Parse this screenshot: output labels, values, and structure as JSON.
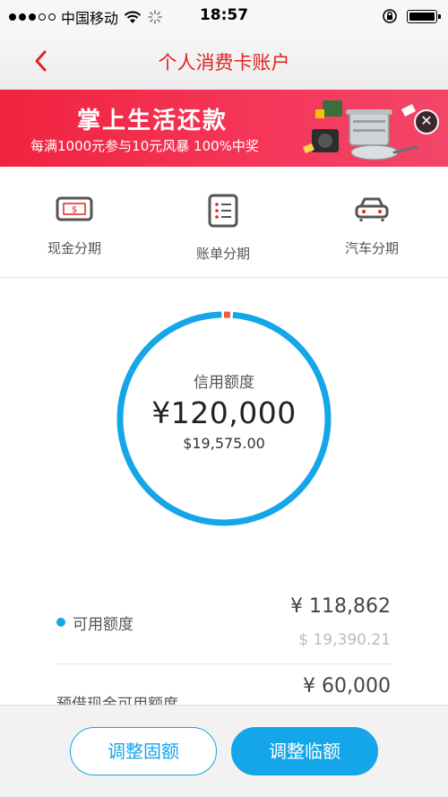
{
  "status_bar": {
    "carrier": "中国移动",
    "time": "18:57",
    "signal_bars_filled": 3,
    "signal_bars_total": 5
  },
  "nav": {
    "title": "个人消费卡账户"
  },
  "banner": {
    "headline": "掌上生活还款",
    "subtitle": "每满1000元参与10元风暴 100%中奖",
    "close_symbol": "✕"
  },
  "installments": [
    {
      "label": "现金分期",
      "icon": "cash-card-icon"
    },
    {
      "label": "账单分期",
      "icon": "bill-list-icon"
    },
    {
      "label": "汽车分期",
      "icon": "car-icon"
    }
  ],
  "credit": {
    "title": "信用额度",
    "amount_cny": "¥120,000",
    "amount_usd": "$19,575.00",
    "used_fraction": 0.0095
  },
  "available": {
    "label": "可用额度",
    "cny": "¥ 118,862",
    "usd": "$ 19,390.21"
  },
  "cash_advance": {
    "label": "预借现金可用额度",
    "cny": "¥ 60,000"
  },
  "buttons": {
    "adjust_fixed": "调整固额",
    "adjust_temp": "调整临额"
  },
  "colors": {
    "brand_red": "#e2241f",
    "accent_blue": "#14a6e8",
    "used_marker": "#f15a3a"
  }
}
